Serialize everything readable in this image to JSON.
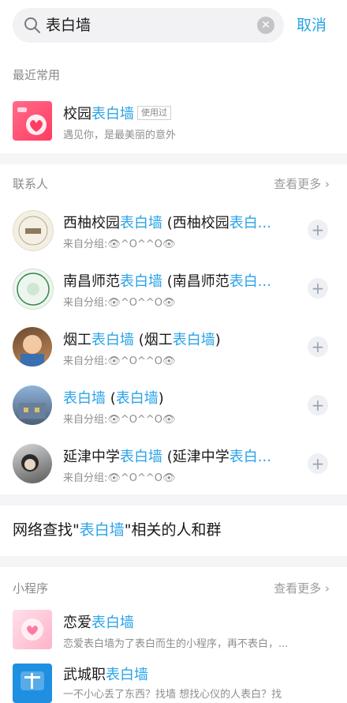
{
  "search": {
    "query": "表白墙",
    "cancel_label": "取消"
  },
  "recent": {
    "section_label": "最近常用",
    "item": {
      "title_prefix": "校园",
      "title_highlight": "表白墙",
      "tag": "使用过",
      "subtitle": "遇见你，是最美丽的意外"
    }
  },
  "contacts": {
    "section_label": "联系人",
    "more_label": "查看更多",
    "items": [
      {
        "pre": "西柚校园",
        "hl": "表白墙",
        "mid": "(西柚校园",
        "hl2": "表白...",
        "post": "",
        "sub": "来自分组:👁^O^^O👁"
      },
      {
        "pre": "南昌师范",
        "hl": "表白墙",
        "mid": "(南昌师范",
        "hl2": "表白...",
        "post": "",
        "sub": "来自分组:👁^O^^O👁"
      },
      {
        "pre": "烟工",
        "hl": "表白墙",
        "mid": "(烟工",
        "hl2": "表白墙",
        "post": ")",
        "sub": "来自分组:👁^O^^O👁"
      },
      {
        "pre": "",
        "hl": "表白墙",
        "mid": "(",
        "hl2": "表白墙",
        "post": ")",
        "sub": "来自分组:👁^O^^O👁"
      },
      {
        "pre": "延津中学",
        "hl": "表白墙",
        "mid": "(延津中学",
        "hl2": "表白...",
        "post": "",
        "sub": "来自分组:👁^O^^O👁"
      }
    ]
  },
  "web_search": {
    "prefix": "网络查找\"",
    "highlight": "表白墙",
    "suffix": "\"相关的人和群"
  },
  "mini_programs": {
    "section_label": "小程序",
    "more_label": "查看更多",
    "items": [
      {
        "pre": "恋爱",
        "hl": "表白墙",
        "sub": "恋爱表白墙为了表白而生的小程序，再不表白，..."
      },
      {
        "pre": "武城职",
        "hl": "表白墙",
        "sub": "一不小心丢了东西？找墙 想找心仪的人表白？找"
      }
    ]
  },
  "colors": {
    "accent": "#2aa3e8",
    "background": "#ffffff",
    "divider": "#f5f5f7"
  }
}
